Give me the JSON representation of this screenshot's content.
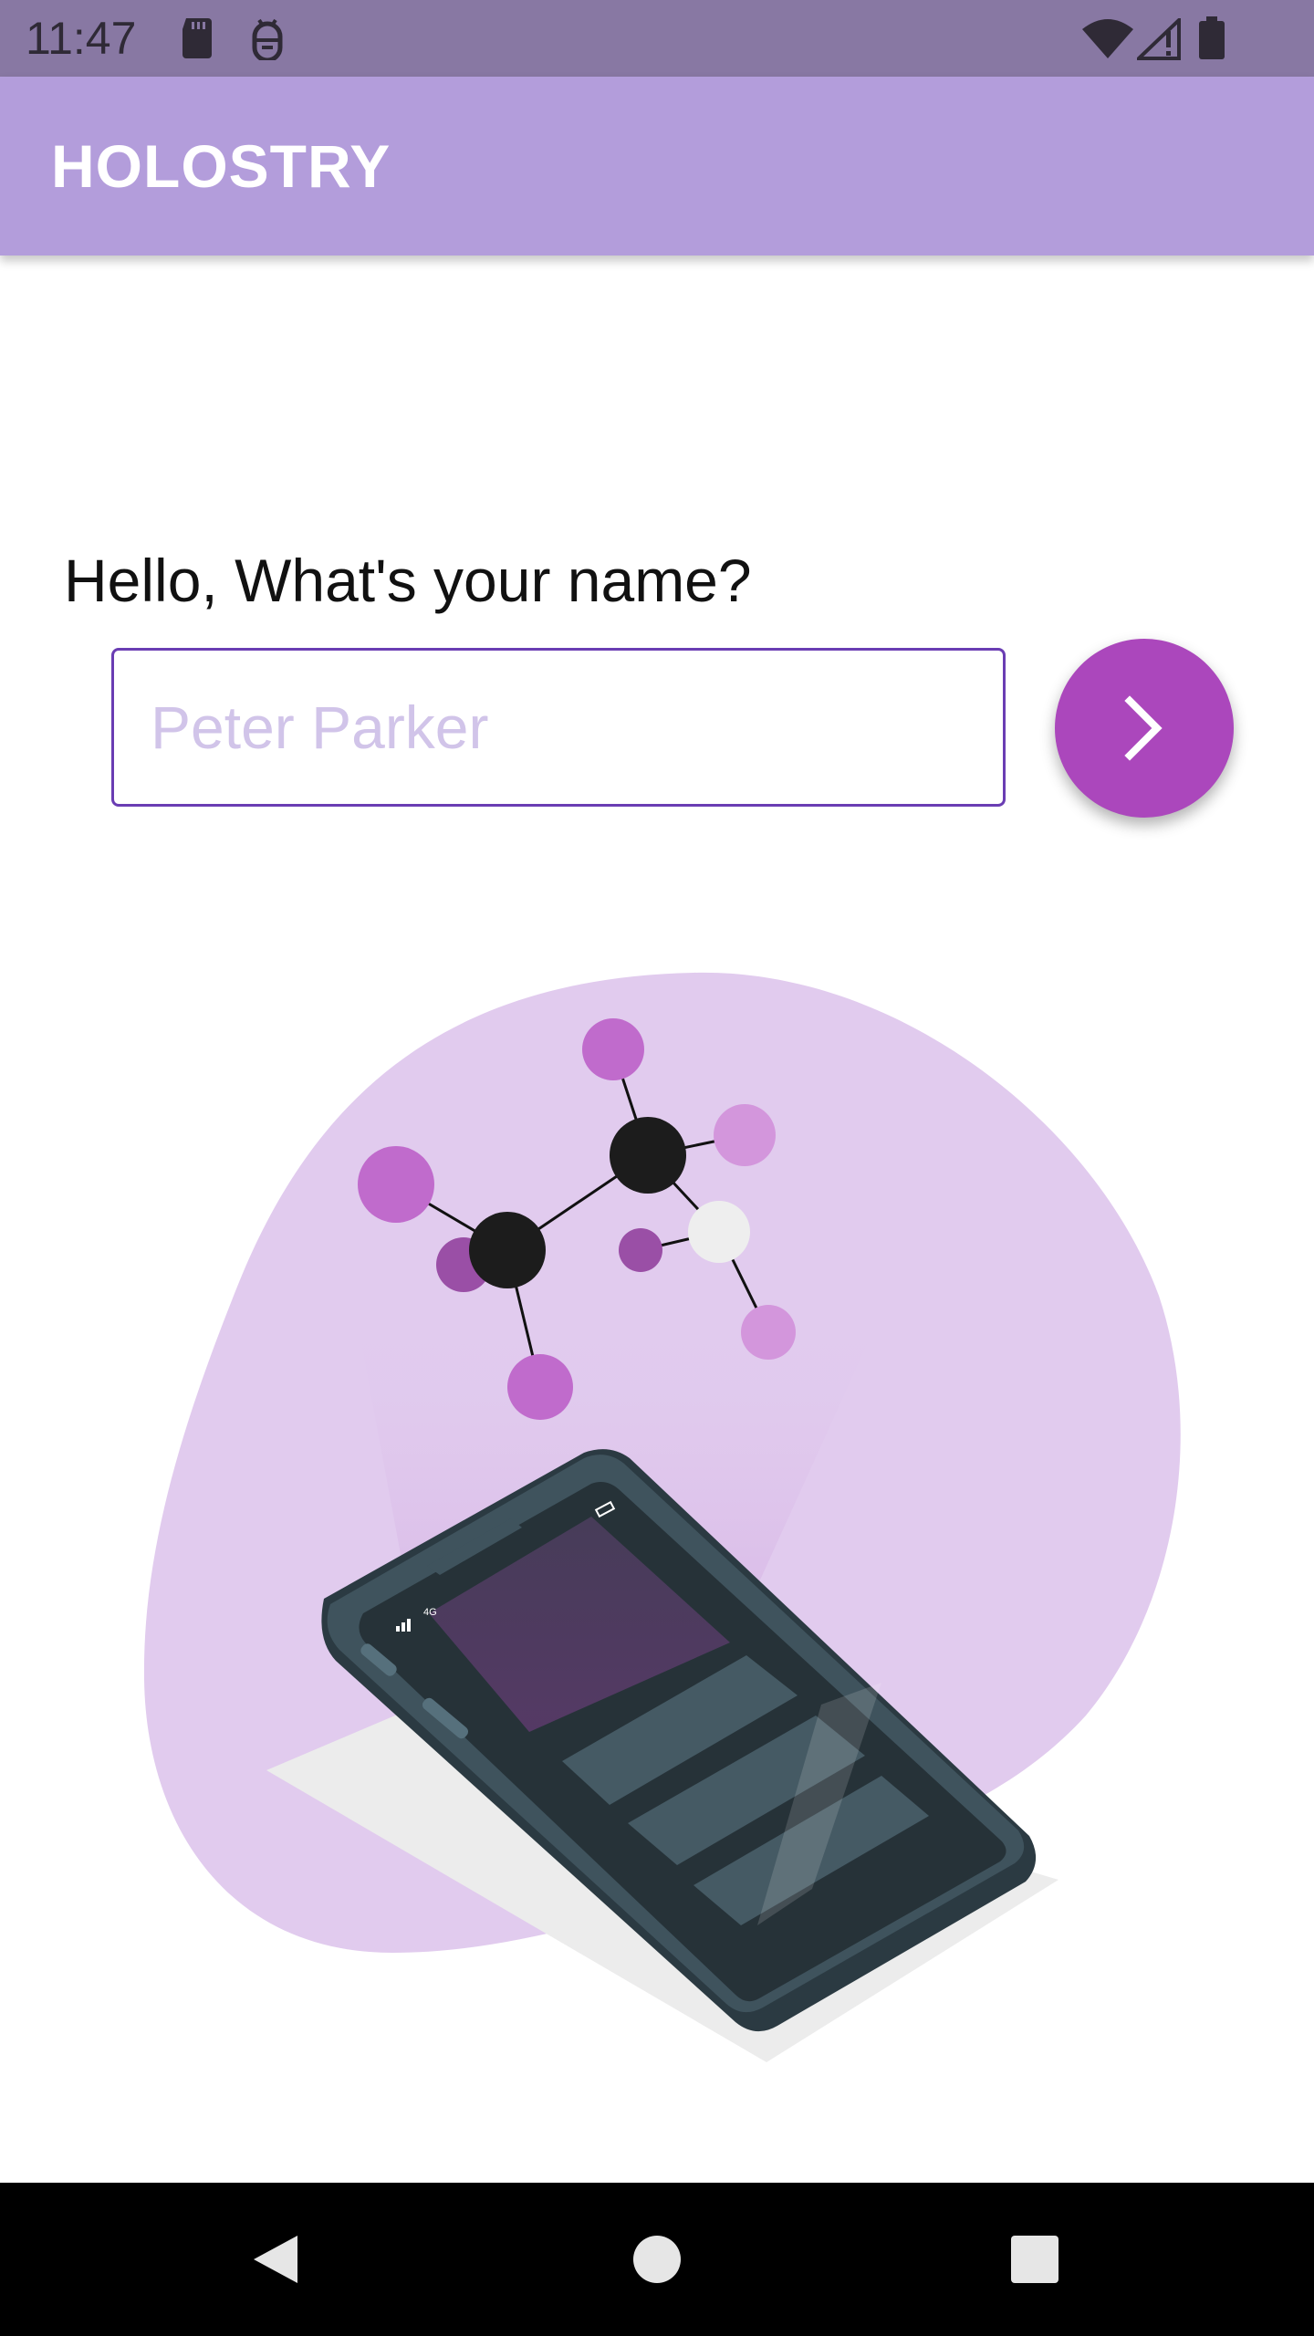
{
  "status_bar": {
    "time": "11:47",
    "icons": [
      "sd-card-icon",
      "android-debug-icon",
      "wifi-icon",
      "signal-icon",
      "battery-icon"
    ]
  },
  "app_bar": {
    "title": "HOLOSTRY"
  },
  "form": {
    "prompt": "Hello, What's your name?",
    "name_value": "",
    "name_placeholder": "Peter Parker",
    "next_icon": "chevron-right-icon"
  },
  "illustration": {
    "subject": "molecule-hologram-over-phone",
    "phone_status_text": "4G"
  },
  "nav_bar": {
    "buttons": [
      "back-icon",
      "home-icon",
      "recents-icon"
    ]
  },
  "colors": {
    "status_bar": "#8878a3",
    "app_bar": "#b39ddb",
    "accent": "#ab47bc",
    "input_border": "#6a3db3",
    "placeholder": "#d1c4e9",
    "blob": "#e1cbee"
  }
}
